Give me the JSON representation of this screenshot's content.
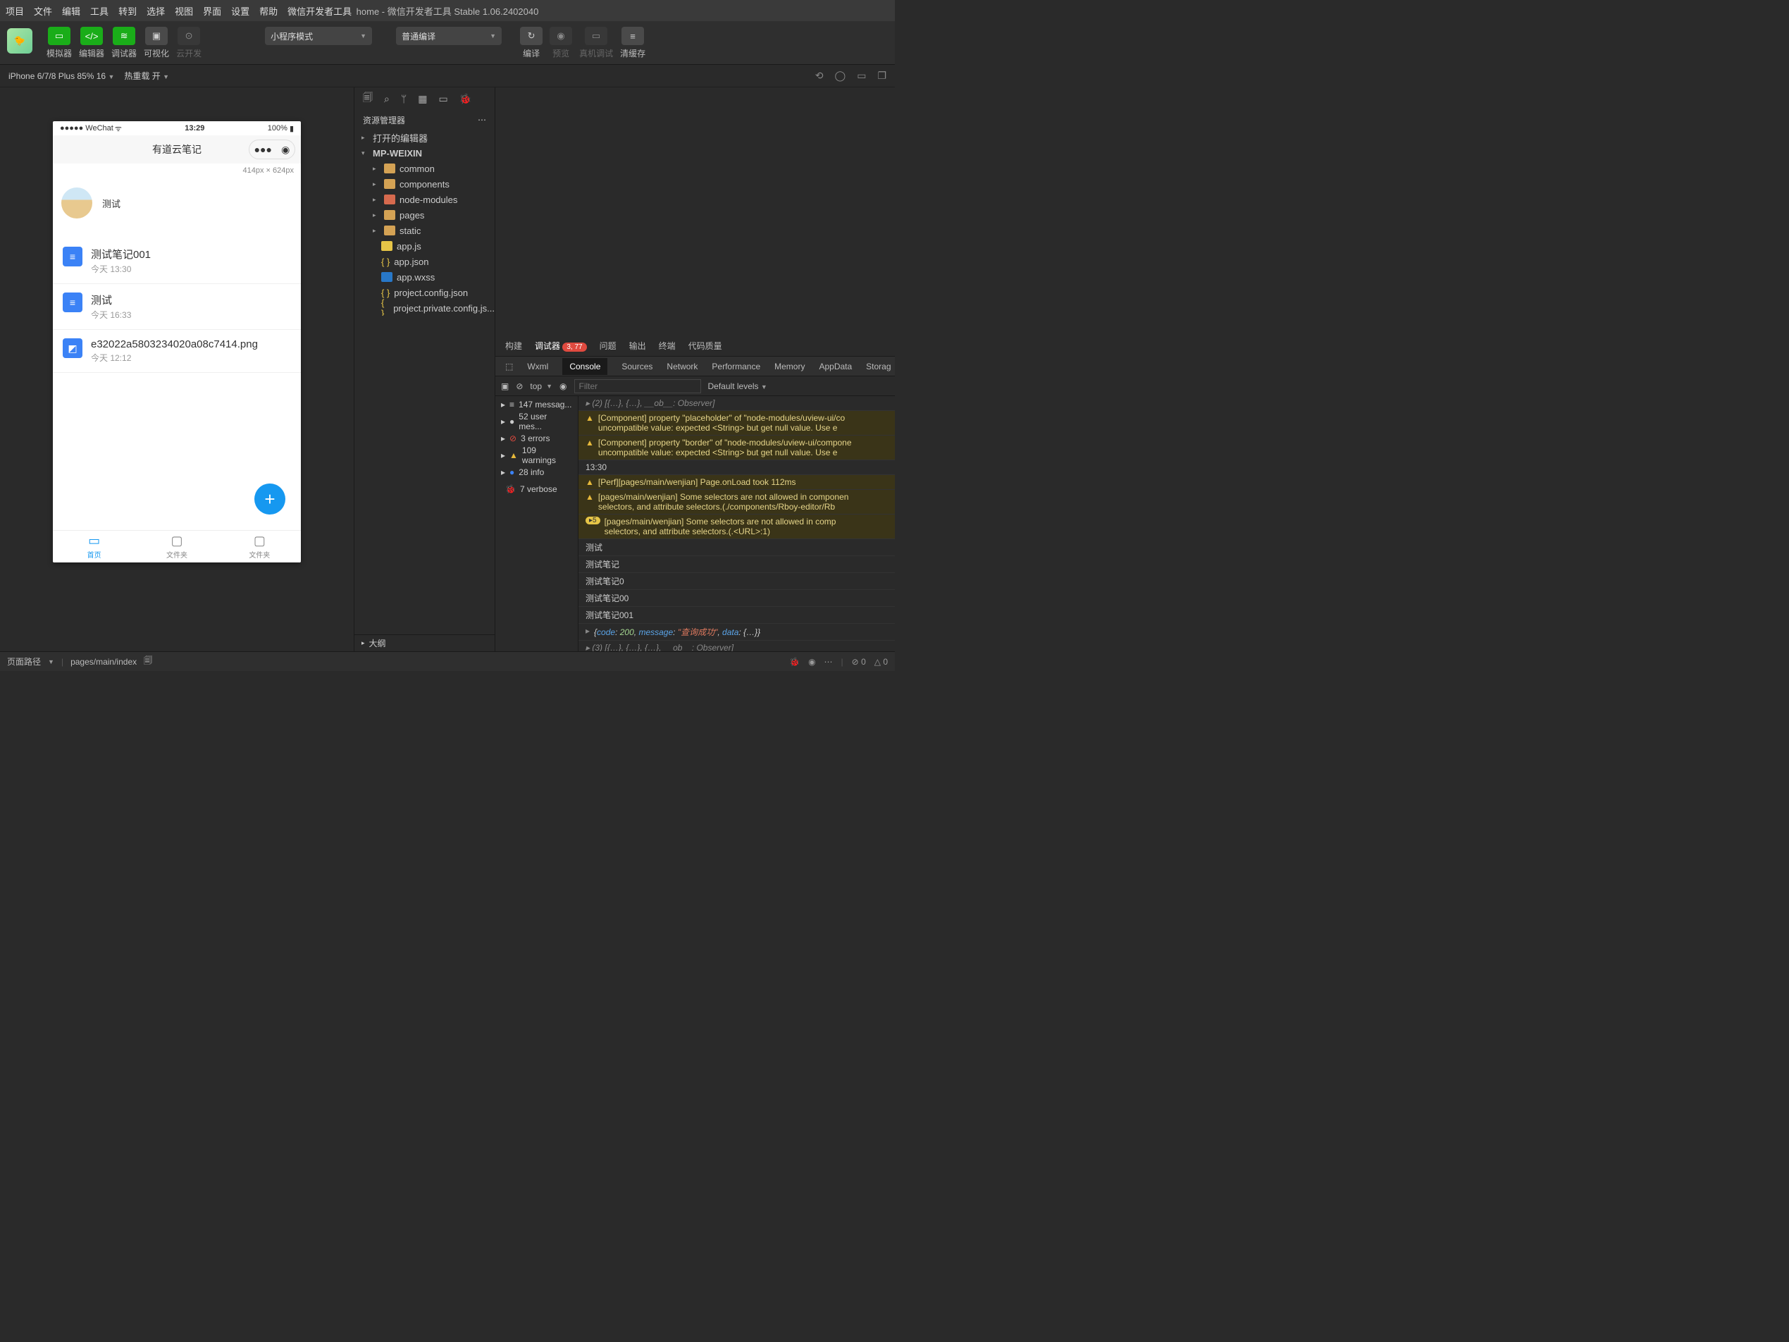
{
  "menu": [
    "项目",
    "文件",
    "编辑",
    "工具",
    "转到",
    "选择",
    "视图",
    "界面",
    "设置",
    "帮助",
    "微信开发者工具"
  ],
  "window_title": "home - 微信开发者工具 Stable 1.06.2402040",
  "toolbar": {
    "btns": [
      {
        "label": "模拟器",
        "icon": "▢"
      },
      {
        "label": "编辑器",
        "icon": "</>"
      },
      {
        "label": "调试器",
        "icon": "≋"
      },
      {
        "label": "可视化",
        "icon": "▣"
      },
      {
        "label": "云开发",
        "icon": "⊙"
      }
    ],
    "mode": "小程序模式",
    "compile": "普通编译",
    "actions": [
      {
        "label": "编译",
        "icon": "↻"
      },
      {
        "label": "预览",
        "icon": "👁"
      },
      {
        "label": "真机调试",
        "icon": "▭"
      },
      {
        "label": "清缓存",
        "icon": "≡"
      }
    ]
  },
  "device_bar": {
    "device": "iPhone 6/7/8 Plus 85% 16",
    "reload": "热重载 开"
  },
  "sim": {
    "carrier": "●●●●● WeChat",
    "wifi": "⊚",
    "time": "13:29",
    "battery": "100%",
    "app_title": "有道云笔记",
    "size_label": "414px × 624px",
    "user": "测试",
    "notes": [
      {
        "title": "测试笔记001",
        "sub": "今天 13:30",
        "ico": "doc"
      },
      {
        "title": "测试",
        "sub": "今天 16:33",
        "ico": "doc"
      },
      {
        "title": "e32022a5803234020a08c7414.png",
        "sub": "今天 12:12",
        "ico": "img"
      }
    ],
    "tabs": [
      {
        "label": "首页",
        "active": true
      },
      {
        "label": "文件夹"
      },
      {
        "label": "文件夹"
      }
    ]
  },
  "explorer": {
    "panel_title": "资源管理器",
    "sections": {
      "open": "打开的编辑器",
      "root": "MP-WEIXIN"
    },
    "files": [
      {
        "name": "common",
        "type": "folder"
      },
      {
        "name": "components",
        "type": "folder"
      },
      {
        "name": "node-modules",
        "type": "folder-red"
      },
      {
        "name": "pages",
        "type": "folder"
      },
      {
        "name": "static",
        "type": "folder"
      },
      {
        "name": "app.js",
        "type": "js"
      },
      {
        "name": "app.json",
        "type": "json"
      },
      {
        "name": "app.wxss",
        "type": "css"
      },
      {
        "name": "project.config.json",
        "type": "json"
      },
      {
        "name": "project.private.config.js...",
        "type": "json"
      }
    ],
    "outline": "大纲"
  },
  "panel": {
    "tabs": [
      "构建",
      "调试器",
      "问题",
      "输出",
      "终端",
      "代码质量"
    ],
    "active": "调试器",
    "badge": "3, 77",
    "devtools": [
      "Wxml",
      "Console",
      "Sources",
      "Network",
      "Performance",
      "Memory",
      "AppData",
      "Storag"
    ],
    "devtools_active": "Console",
    "context": "top",
    "filter_placeholder": "Filter",
    "levels": "Default levels",
    "sidebar": [
      {
        "label": "147 messag...",
        "icon": "≡"
      },
      {
        "label": "52 user mes...",
        "icon": "👤"
      },
      {
        "label": "3 errors",
        "icon": "err"
      },
      {
        "label": "109 warnings",
        "icon": "warn"
      },
      {
        "label": "28 info",
        "icon": "info"
      },
      {
        "label": "7 verbose",
        "icon": "debug"
      }
    ],
    "messages": [
      {
        "type": "log",
        "text": "▸ (2) [{…}, {…}, __ob__: Observer]"
      },
      {
        "type": "warn",
        "text": "[Component] property \"placeholder\" of \"node-modules/uview-ui/co\nuncompatible value: expected <String> but get null value. Use e"
      },
      {
        "type": "warn",
        "text": "[Component] property \"border\" of \"node-modules/uview-ui/compone\nuncompatible value: expected <String> but get null value. Use e"
      },
      {
        "type": "log",
        "text": "13:30"
      },
      {
        "type": "warn",
        "text": "[Perf][pages/main/wenjian] Page.onLoad took 112ms"
      },
      {
        "type": "warn",
        "text": "[pages/main/wenjian] Some selectors are not allowed in componen\nselectors, and attribute selectors.(./components/Rboy-editor/Rb"
      },
      {
        "type": "warn",
        "pill": "5",
        "text": "[pages/main/wenjian] Some selectors are not allowed in comp\nselectors, and attribute selectors.(.<URL>:1)"
      },
      {
        "type": "log",
        "text": "测试"
      },
      {
        "type": "log",
        "text": "测试笔记"
      },
      {
        "type": "log",
        "text": "测试笔记0"
      },
      {
        "type": "log",
        "text": "测试笔记00"
      },
      {
        "type": "log",
        "text": "测试笔记001"
      },
      {
        "type": "obj",
        "text": "{code: 200, message: \"查询成功\", data: {…}}"
      },
      {
        "type": "log",
        "text": "▸ (3) [{…}, {…}, {…}, __ob__: Observer]"
      }
    ]
  },
  "status": {
    "path_label": "页面路径",
    "path": "pages/main/index",
    "errors": "0",
    "warnings": "0"
  }
}
